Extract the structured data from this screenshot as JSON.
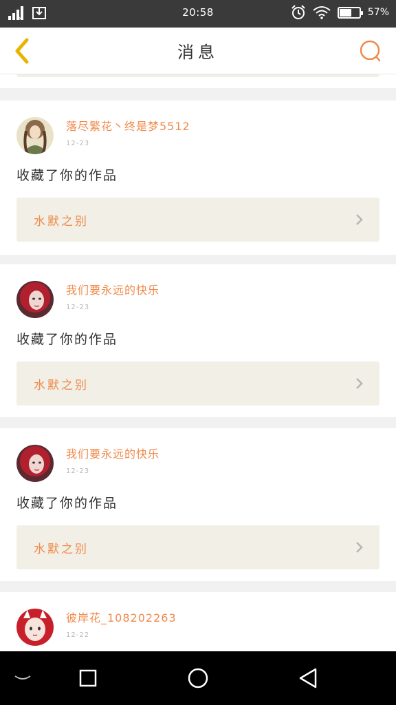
{
  "status_bar": {
    "time": "20:58",
    "battery_percent": "57%",
    "battery_level": 0.57
  },
  "navbar": {
    "title": "消息",
    "back_icon": "chevron-left-icon",
    "search_icon": "search-icon"
  },
  "colors": {
    "accent": "#f08a4b",
    "back_icon": "#e8b400",
    "work_box": "#f1efe6",
    "divider": "#f1f1f1"
  },
  "messages": [
    {
      "username": "落尽繁花丶终是梦5512",
      "date": "12-23",
      "action": "收藏了你的作品",
      "work_title": "水默之别"
    },
    {
      "username": "我们要永远的快乐",
      "date": "12-23",
      "action": "收藏了你的作品",
      "work_title": "水默之别"
    },
    {
      "username": "我们要永远的快乐",
      "date": "12-23",
      "action": "收藏了你的作品",
      "work_title": "水默之别"
    },
    {
      "username": "彼岸花_108202263",
      "date": "12-22"
    }
  ],
  "system_nav": {
    "buttons": [
      "collapse-icon",
      "recents-icon",
      "home-icon",
      "back-icon"
    ]
  }
}
